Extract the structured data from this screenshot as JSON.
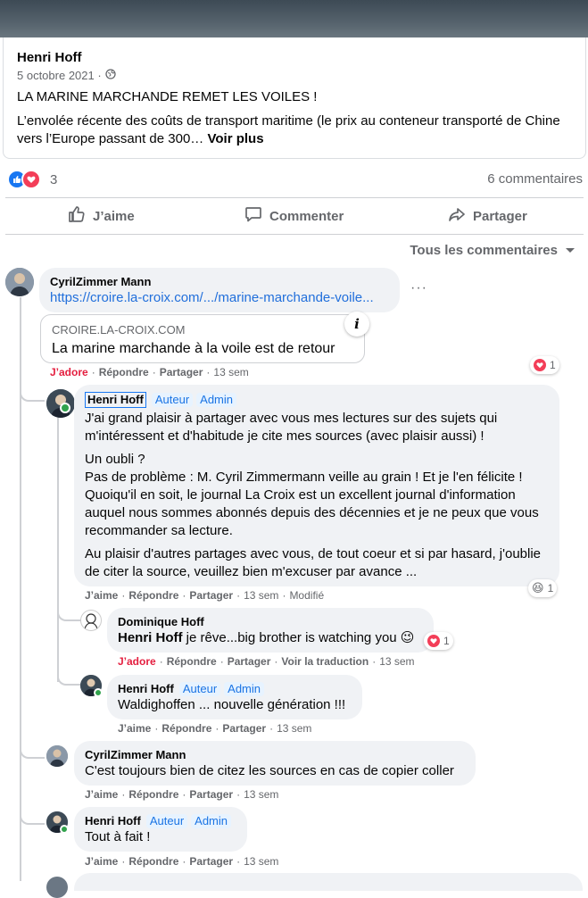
{
  "post": {
    "author": "Henri Hoff",
    "date": "5 octobre 2021 ·",
    "headline": "LA MARINE MARCHANDE REMET LES VOILES !",
    "body": "L’envolée récente des coûts de transport maritime (le prix au conteneur transporté de Chine vers l’Europe passant de 300…",
    "see_more": "Voir plus"
  },
  "stats": {
    "reactions": "3",
    "comments": "6 commentaires"
  },
  "actions": {
    "like": "J’aime",
    "comment": "Commenter",
    "share": "Partager"
  },
  "sort_label": "Tous les commentaires",
  "comments": {
    "c1": {
      "name": "CyrilZimmer Mann",
      "link": "https://croire.la-croix.com/.../marine-marchande-voile...",
      "preview_domain": "CROIRE.LA-CROIX.COM",
      "preview_title": "La marine marchande à la voile est de retour",
      "like": "J’adore",
      "reply": "Répondre",
      "share": "Partager",
      "time": "13 sem",
      "react_count": "1"
    },
    "c2": {
      "name": "Henri Hoff",
      "tag1": "Auteur",
      "tag2": "Admin",
      "p1": "J'ai grand plaisir à partager avec vous mes lectures sur des sujets qui m'intéressent et d'habitude je cite mes sources (avec plaisir aussi) !",
      "p2a": "Un oubli ?",
      "p2b": "Pas de problème : M. Cyril Zimmermann veille au grain ! Et je l'en félicite ! Quoiqu'il en soit, le journal La Croix est un excellent journal d'information auquel nous sommes abonnés depuis des décennies et je ne peux que vous recommander sa lecture.",
      "p3": "Au plaisir d'autres partages avec vous, de tout coeur et si par hasard, j'oublie de citer la source, veuillez bien m'excuser par avance ...",
      "like": "J’aime",
      "reply": "Répondre",
      "share": "Partager",
      "time": "13 sem",
      "edited": "Modifié",
      "react_count": "1"
    },
    "c3": {
      "name": "Dominique Hoff",
      "mention": "Henri Hoff",
      "text": " je rêve...big brother is watching you 😉",
      "like": "J’adore",
      "reply": "Répondre",
      "share": "Partager",
      "translate": "Voir la traduction",
      "time": "13 sem",
      "react_count": "1"
    },
    "c4": {
      "name": "Henri Hoff",
      "tag1": "Auteur",
      "tag2": "Admin",
      "text": "Waldighoffen ... nouvelle génération !!!",
      "like": "J’aime",
      "reply": "Répondre",
      "share": "Partager",
      "time": "13 sem"
    },
    "c5": {
      "name": "CyrilZimmer Mann",
      "text": "C'est toujours bien de citez les sources en cas de copier coller",
      "like": "J’aime",
      "reply": "Répondre",
      "share": "Partager",
      "time": "13 sem"
    },
    "c6": {
      "name": "Henri Hoff",
      "tag1": "Auteur",
      "tag2": "Admin",
      "text": "Tout à fait !",
      "like": "J’aime",
      "reply": "Répondre",
      "share": "Partager",
      "time": "13 sem"
    }
  },
  "colors": {
    "like_blue": "#1877f2",
    "love_red": "#f33e58",
    "link_blue": "#216fdb"
  }
}
